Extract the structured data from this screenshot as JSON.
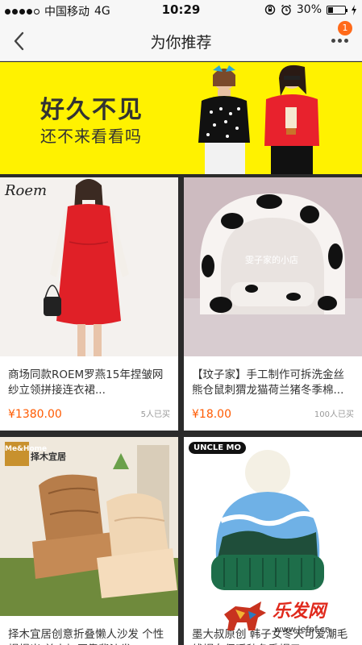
{
  "status_bar": {
    "carrier": "中国移动",
    "network": "4G",
    "time": "10:29",
    "battery_text": "30%",
    "battery_level": 0.3
  },
  "nav": {
    "title": "为你推荐",
    "badge_count": "1"
  },
  "banner": {
    "headline": "好久不见",
    "subline": "还不来看看吗"
  },
  "products": [
    {
      "brand": "Roem",
      "name": "商场同款ROEM罗燕15年捏皱网纱立领拼接连衣裙...",
      "price": "¥1380.00",
      "sold": "5人已买"
    },
    {
      "watermark": "雯子家的小店",
      "name": "【玟子家】手工制作可拆洗金丝熊仓鼠刺猬龙猫荷兰猪冬季棉...",
      "price": "¥18.00",
      "sold": "100人已买"
    },
    {
      "brand_top": "Me&Home",
      "brand_cn": "择木宜居",
      "name": "择木宜居创意折叠懒人沙发 个性榻榻米 单人加厚靠背沙发..."
    },
    {
      "brand": "UNCLE MO",
      "name": "墨大叔原创 韩子女冬天可爱潮毛线帽女保暖秋冬季帽子..."
    }
  ],
  "watermark": {
    "cn": "乐发网",
    "url": "www.lefpf.cn"
  },
  "colors": {
    "accent": "#ff5a00",
    "banner_bg": "#fff200",
    "badge": "#ff6a1a"
  }
}
